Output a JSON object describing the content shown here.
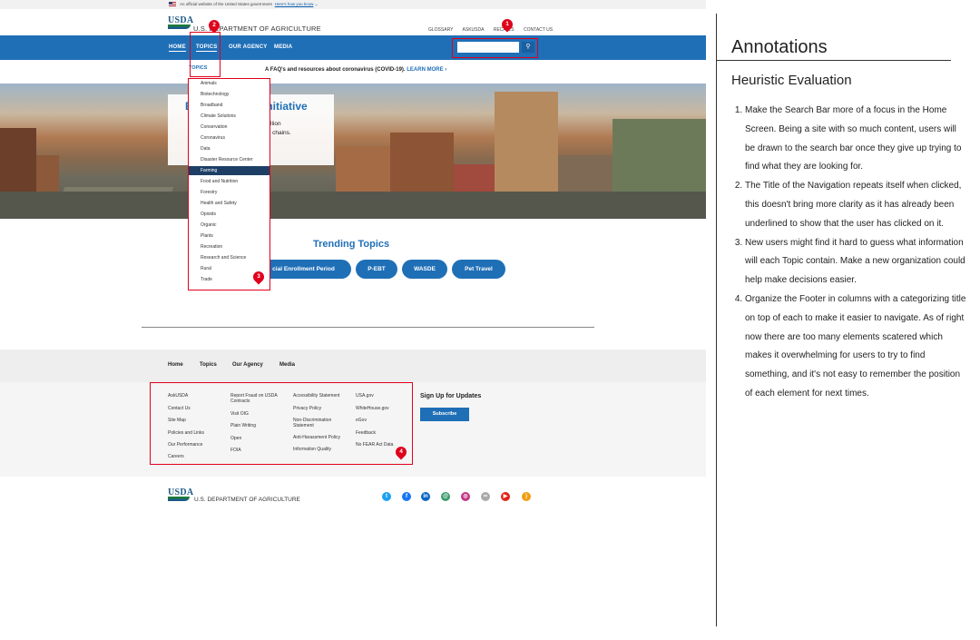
{
  "gov_banner": {
    "text": "An official website of the United States government",
    "link": "Here's how you know"
  },
  "header": {
    "logo": "USDA",
    "department": "U.S. DEPARTMENT OF AGRICULTURE",
    "utility": [
      "GLOSSARY",
      "ASKUSDA",
      "RECALLS",
      "CONTACT US"
    ]
  },
  "nav": {
    "home": "HOME",
    "topics": "TOPICS",
    "agency": "OUR AGENCY",
    "media": "MEDIA"
  },
  "search": {
    "placeholder": "",
    "button_icon": "search-icon"
  },
  "alert": {
    "text": "A FAQ's and resources about coronavirus (COVID-19).",
    "link": "LEARN MORE ›"
  },
  "hero": {
    "title_a": "E",
    "title_b": "Initiative",
    "line1": "billion",
    "line2": "ply chains."
  },
  "dropdown": {
    "heading": "TOPICS",
    "items": [
      "Animals",
      "Biotechnology",
      "Broadband",
      "Climate Solutions",
      "Conservation",
      "Coronavirus",
      "Data",
      "Disaster Resource Center",
      "Farming",
      "Food and Nutrition",
      "Forestry",
      "Health and Safety",
      "Opioids",
      "Organic",
      "Plants",
      "Recreation",
      "Research and Science",
      "Rural",
      "Trade"
    ],
    "selected": "Farming"
  },
  "trending": {
    "title": "Trending Topics",
    "pills": [
      "cial Enrollment Period",
      "P-EBT",
      "WASDE",
      "Pet Travel"
    ]
  },
  "footer": {
    "nav": [
      "Home",
      "Topics",
      "Our Agency",
      "Media"
    ],
    "col1": [
      "AskUSDA",
      "Contact Us",
      "Site Map",
      "Policies and Links",
      "Our Performance",
      "Careers"
    ],
    "col2": [
      "Report Fraud on USDA Contracts",
      "Visit OIG",
      "Plain Writing",
      "Open",
      "FOIA"
    ],
    "col3": [
      "Accessibility Statement",
      "Privacy Policy",
      "Non-Discrimination Statement",
      "Anti-Harassment Policy",
      "Information Quality"
    ],
    "col4": [
      "USA.gov",
      "WhiteHouse.gov",
      "eGov",
      "Feedback",
      "No FEAR Act Data"
    ],
    "signup": "Sign Up for Updates",
    "subscribe": "Subscribe",
    "logo": "USDA",
    "department": "U.S. DEPARTMENT OF AGRICULTURE",
    "social": [
      {
        "name": "twitter",
        "color": "#1da1f2",
        "glyph": "t"
      },
      {
        "name": "facebook",
        "color": "#1877f2",
        "glyph": "f"
      },
      {
        "name": "linkedin",
        "color": "#0a66c2",
        "glyph": "in"
      },
      {
        "name": "email",
        "color": "#3a9a6a",
        "glyph": "@"
      },
      {
        "name": "instagram",
        "color": "#c13584",
        "glyph": "◎"
      },
      {
        "name": "flickr",
        "color": "#aaaaaa",
        "glyph": "••"
      },
      {
        "name": "youtube",
        "color": "#e62117",
        "glyph": "▶"
      },
      {
        "name": "rss",
        "color": "#f39c12",
        "glyph": ")"
      }
    ]
  },
  "markers": [
    "1",
    "2",
    "3",
    "4"
  ],
  "annotations": {
    "title": "Annotations",
    "subtitle": "Heuristic Evaluation",
    "items": [
      "Make the Search Bar more of a focus in the Home Screen. Being a site with so much content, users will be drawn to the search bar once they give up trying to find what they are looking for.",
      "The Title of the Navigation repeats itself when clicked, this doesn't bring more clarity as it has already been underlined to show that the user has clicked on it.",
      "New users might find it hard to guess what information will each Topic contain. Make a new organization could help make decisions easier.",
      "Organize the Footer in columns with a categorizing title on top of each to make it easier to navigate. As of right now there are too many elements scatered which makes it overwhelming for users to try to find something, and it's not easy to remember the position of each element for next times."
    ]
  }
}
